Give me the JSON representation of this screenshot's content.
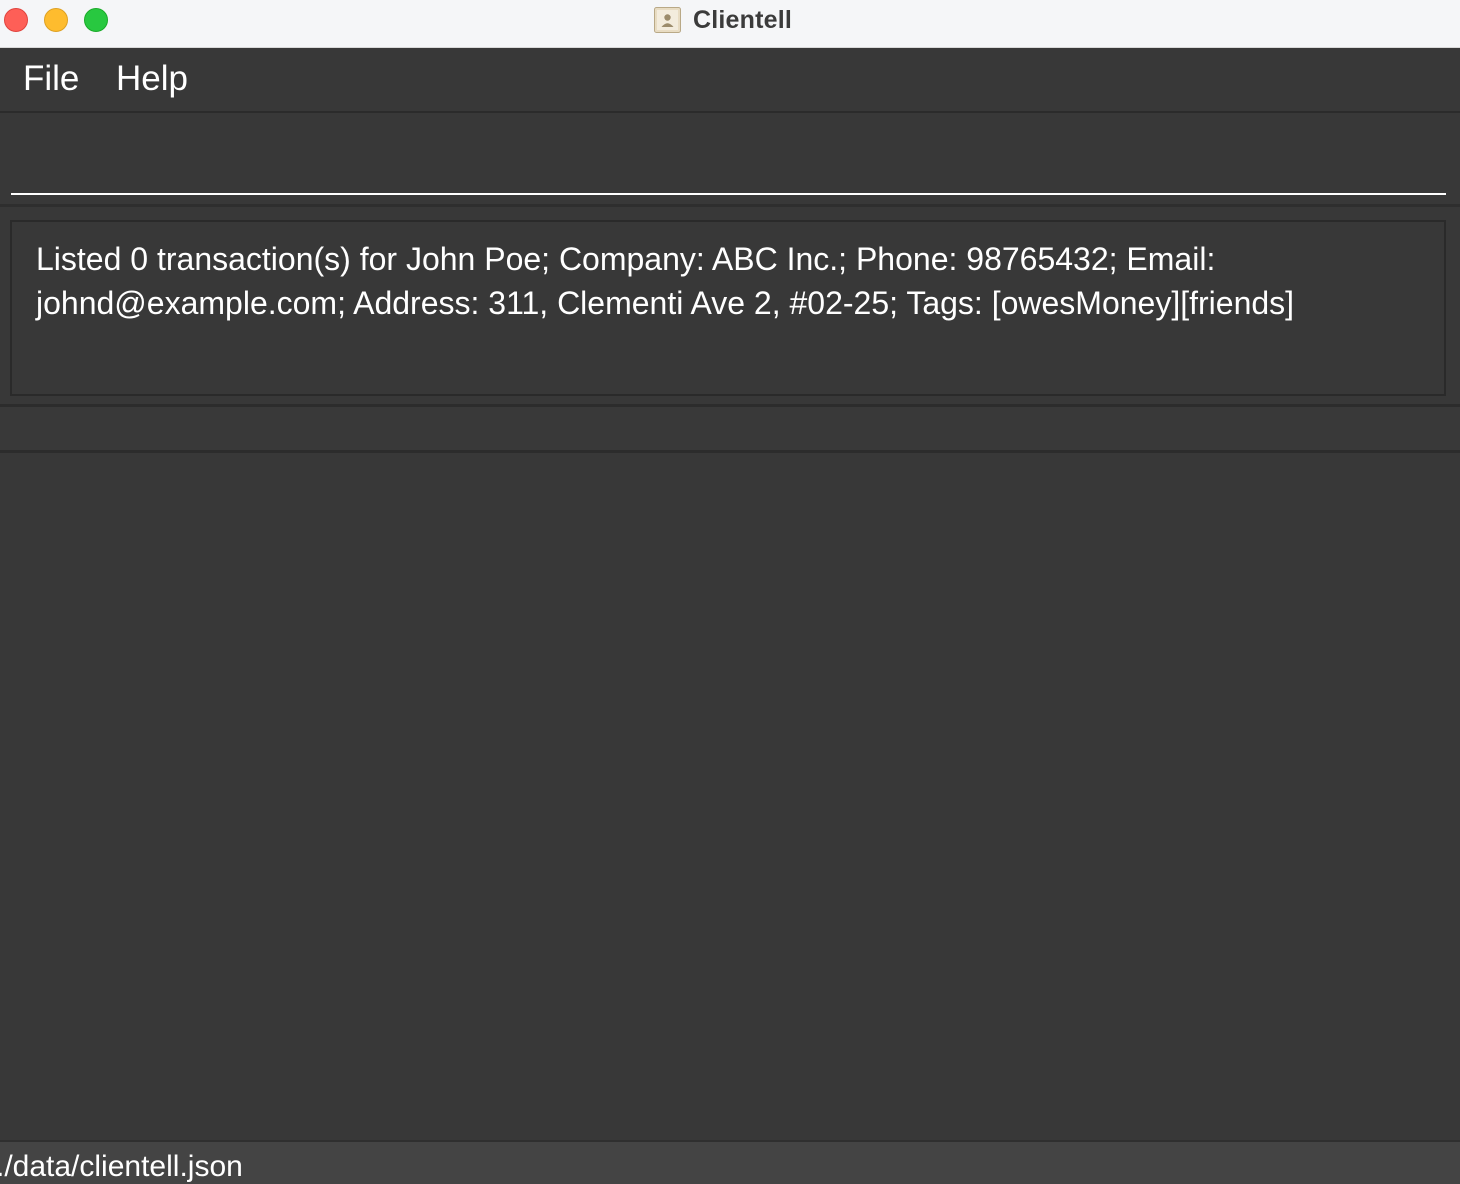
{
  "window": {
    "title": "Clientell",
    "app_icon": "contact-book-icon",
    "controls": [
      "close",
      "minimize",
      "maximize"
    ]
  },
  "menu": {
    "items": [
      {
        "label": "File"
      },
      {
        "label": "Help"
      }
    ]
  },
  "command_box": {
    "value": "",
    "placeholder": ""
  },
  "result_display": {
    "text": "Listed 0 transaction(s) for John Poe; Company: ABC Inc.; Phone: 98765432; Email: johnd@example.com; Address: 311, Clementi Ave 2, #02-25; Tags: [owesMoney][friends]"
  },
  "status_bar": {
    "file_path": "./data/clientell.json"
  },
  "colors": {
    "background": "#383838",
    "titlebar": "#f5f6f8",
    "text": "#ffffff",
    "close": "#fe5f57",
    "minimize": "#febc2e",
    "maximize": "#28c840"
  }
}
